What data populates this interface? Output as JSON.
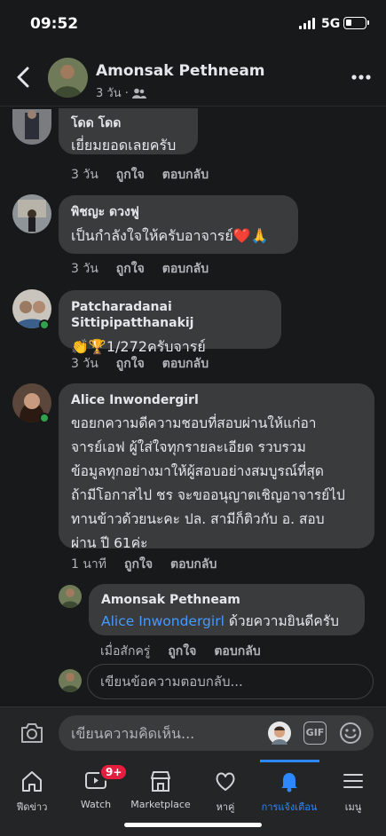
{
  "status_bar": {
    "time": "09:52",
    "network": "5G"
  },
  "header": {
    "name": "Amonsak Pethneam",
    "meta": "3 วัน ·"
  },
  "comments": [
    {
      "name": "โดด โดด",
      "text": "เยี่ยมยอดเลยครับ",
      "time": "3 วัน",
      "like": "ถูกใจ",
      "reply": "ตอบกลับ"
    },
    {
      "name": "พิชญะ ดวงฟู",
      "text": "เป็นกำลังใจให้ครับอาจารย์❤️🙏",
      "time": "3 วัน",
      "like": "ถูกใจ",
      "reply": "ตอบกลับ"
    },
    {
      "name": "Patcharadanai Sittipipatthanakij",
      "text": "👏🏆1/272ครับจารย์",
      "time": "3 วัน",
      "like": "ถูกใจ",
      "reply": "ตอบกลับ"
    },
    {
      "name": "Alice Inwondergirl",
      "lines": [
        "ขอยกความดีความชอบที่สอบผ่านให้แก่อา",
        "จารย์เอฟ ผู้ใส่ใจทุกรายละเอียด รวบรวม",
        "ข้อมูลทุกอย่างมาให้ผู้สอบอย่างสมบูรณ์ที่สุด",
        "ถ้ามีโอกาสไป ชร จะขออนุญาตเชิญอาจารย์ไป",
        "ทานข้าวด้วยนะคะ ปล. สามีก็ติวกับ อ. สอบ",
        "ผ่าน ปี 61ค่ะ"
      ],
      "time": "1 นาที",
      "like": "ถูกใจ",
      "reply": "ตอบกลับ"
    }
  ],
  "reply_comment": {
    "name": "Amonsak Pethneam",
    "mention": "Alice Inwondergirl",
    "text": " ด้วยความยินดีครับ",
    "time": "เมื่อสักครู่",
    "like": "ถูกใจ",
    "reply": "ตอบกลับ"
  },
  "reply_input": {
    "placeholder": "เขียนข้อความตอบกลับ..."
  },
  "composer": {
    "placeholder": "เขียนความคิดเห็น...",
    "gif": "GIF"
  },
  "tabs": [
    {
      "label": "ฟีดข่าว",
      "icon": "home-icon"
    },
    {
      "label": "Watch",
      "icon": "watch-icon",
      "badge": "9+"
    },
    {
      "label": "Marketplace",
      "icon": "marketplace-icon"
    },
    {
      "label": "หาคู่",
      "icon": "heart-icon"
    },
    {
      "label": "การแจ้งเตือน",
      "icon": "bell-icon",
      "active": true
    },
    {
      "label": "เมนู",
      "icon": "menu-icon"
    }
  ],
  "colors": {
    "background": "#18191a",
    "bubble": "#3a3b3c",
    "accent": "#2d88ff",
    "online": "#31a24c",
    "badge": "#e41e3f"
  }
}
